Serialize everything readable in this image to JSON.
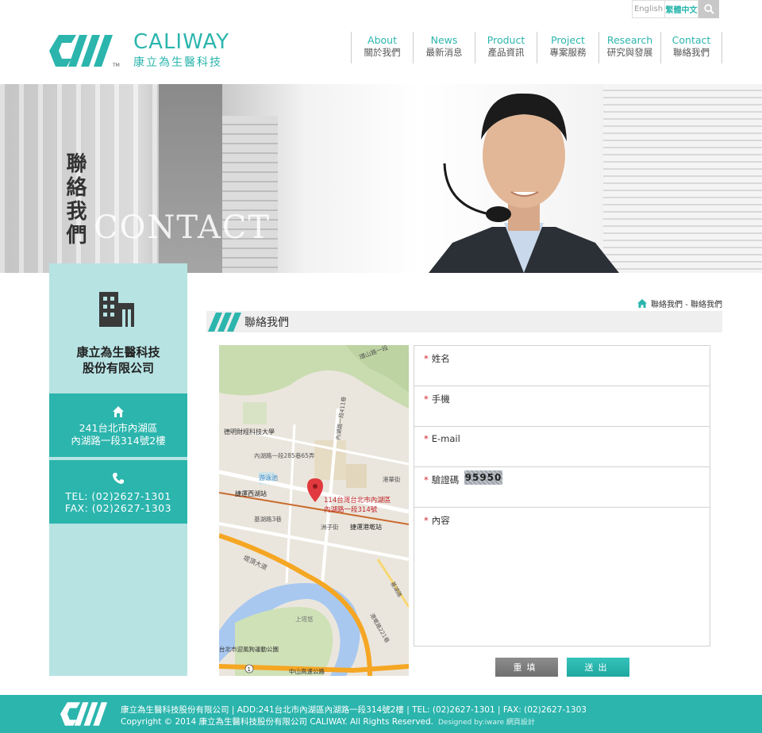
{
  "utility": {
    "lang_en": "English",
    "lang_zh": "繁體中文"
  },
  "logo": {
    "name_en": "CALIWAY",
    "name_zh": "康立為生醫科技",
    "tm": "TM"
  },
  "nav": [
    {
      "en": "About",
      "zh": "關於我們"
    },
    {
      "en": "News",
      "zh": "最新消息"
    },
    {
      "en": "Product",
      "zh": "產品資訊"
    },
    {
      "en": "Project",
      "zh": "專案服務"
    },
    {
      "en": "Research",
      "zh": "研究與發展"
    },
    {
      "en": "Contact",
      "zh": "聯絡我們"
    }
  ],
  "banner": {
    "title_zh": "聯絡我們",
    "title_en": "CONTACT"
  },
  "sidebar": {
    "company_line1": "康立為生醫科技",
    "company_line2": "股份有限公司",
    "address_line1": "241台北市內湖區",
    "address_line2": "內湖路一段314號2樓",
    "tel": "TEL: (02)2627-1301",
    "fax": "FAX: (02)2627-1303"
  },
  "breadcrumb": {
    "text": "聯絡我們 - 聯絡我們"
  },
  "section": {
    "title": "聯絡我們"
  },
  "map": {
    "labels": {
      "university": "德明財經科技大學",
      "road1": "內湖路一段285巷65弄",
      "pool": "游泳池",
      "station_west": "捷運西湖站",
      "station_gangqian": "捷運港墘站",
      "park": "台北市迎風狗運動公園",
      "highway": "堤頂大道",
      "expressway": "中山高速公路",
      "lane": "洲子街",
      "alley": "基湖路3巷",
      "upper": "上塔悠",
      "huan": "環山路一段",
      "gangxi": "港華街",
      "marker_line1": "114台灣台北市內湖區",
      "marker_line2": "內湖路一段314號",
      "lane411": "內湖路一段411巷",
      "lane21": "港墘路221巷",
      "jinghu": "基湖路",
      "gang_shield": "1"
    }
  },
  "form": {
    "name_label": "姓名",
    "phone_label": "手機",
    "email_label": "E-mail",
    "captcha_label": "驗證碼",
    "captcha_code": "95950",
    "content_label": "內容",
    "required_mark": "*",
    "reset_label": "重填",
    "submit_label": "送出"
  },
  "footer": {
    "line1": "康立為生醫科技股份有限公司 | ADD:241台北市內湖區內湖路一段314號2樓 | TEL: (02)2627-1301 | FAX: (02)2627-1303",
    "line2": "Copyright © 2014 康立為生醫科技股份有限公司 CALIWAY. All Rights Reserved.",
    "design": "Designed by:iware 網頁設計"
  },
  "colors": {
    "accent": "#2bb5ad",
    "sidebar_light": "#b7e3e3",
    "required": "#d2262e"
  }
}
